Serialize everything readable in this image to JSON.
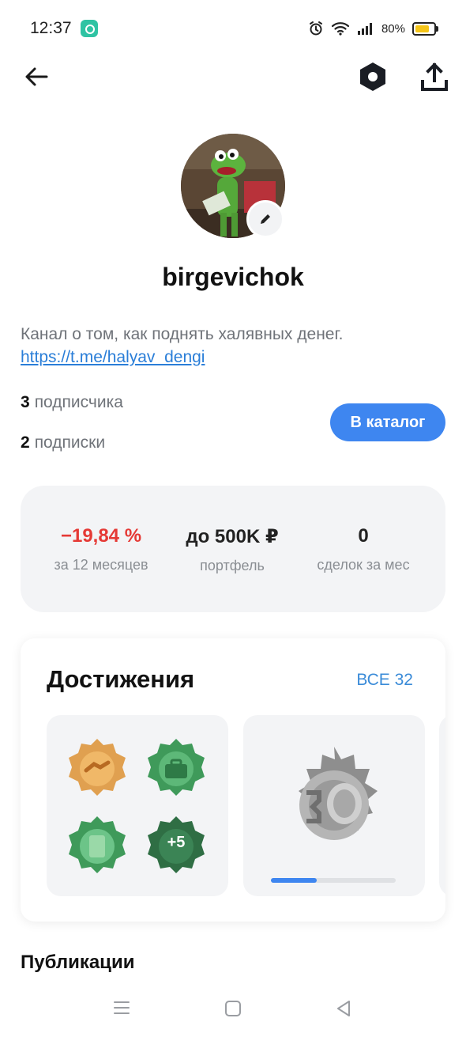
{
  "status": {
    "time": "12:37",
    "battery": "80%",
    "battery_level": 0.8
  },
  "nav": {
    "back_icon": "arrow-left-icon",
    "settings_icon": "gear-hexagon-icon",
    "share_icon": "share-upload-icon"
  },
  "profile": {
    "avatar_icon": "avatar-image",
    "edit_icon": "pencil-icon",
    "username": "birgevichok",
    "bio_text": "Канал о том, как поднять халявных денег.",
    "bio_link": "https://t.me/halyav_dengi",
    "subscribers_count": "3",
    "subscribers_label": "подписчика",
    "subscriptions_count": "2",
    "subscriptions_label": "подписки",
    "catalog_button": "В каталог"
  },
  "metrics": [
    {
      "value": "−19,84 %",
      "label": "за 12 месяцев",
      "color": "#e53935"
    },
    {
      "value": "до 500K ₽",
      "label": "портфель",
      "color": "#222222"
    },
    {
      "value": "0",
      "label": "сделок за мес",
      "color": "#222222"
    }
  ],
  "achievements": {
    "title": "Достижения",
    "all_link": "ВСЕ 32",
    "extra_badges": "+5",
    "progress": 0.37,
    "badge_colors": {
      "gold": "#e0a050",
      "green": "#3f9a5a",
      "dark_green": "#2f6e44",
      "silver": "#9a9a9a"
    }
  },
  "publications_title": "Публикации",
  "accent": "#3e86f0"
}
